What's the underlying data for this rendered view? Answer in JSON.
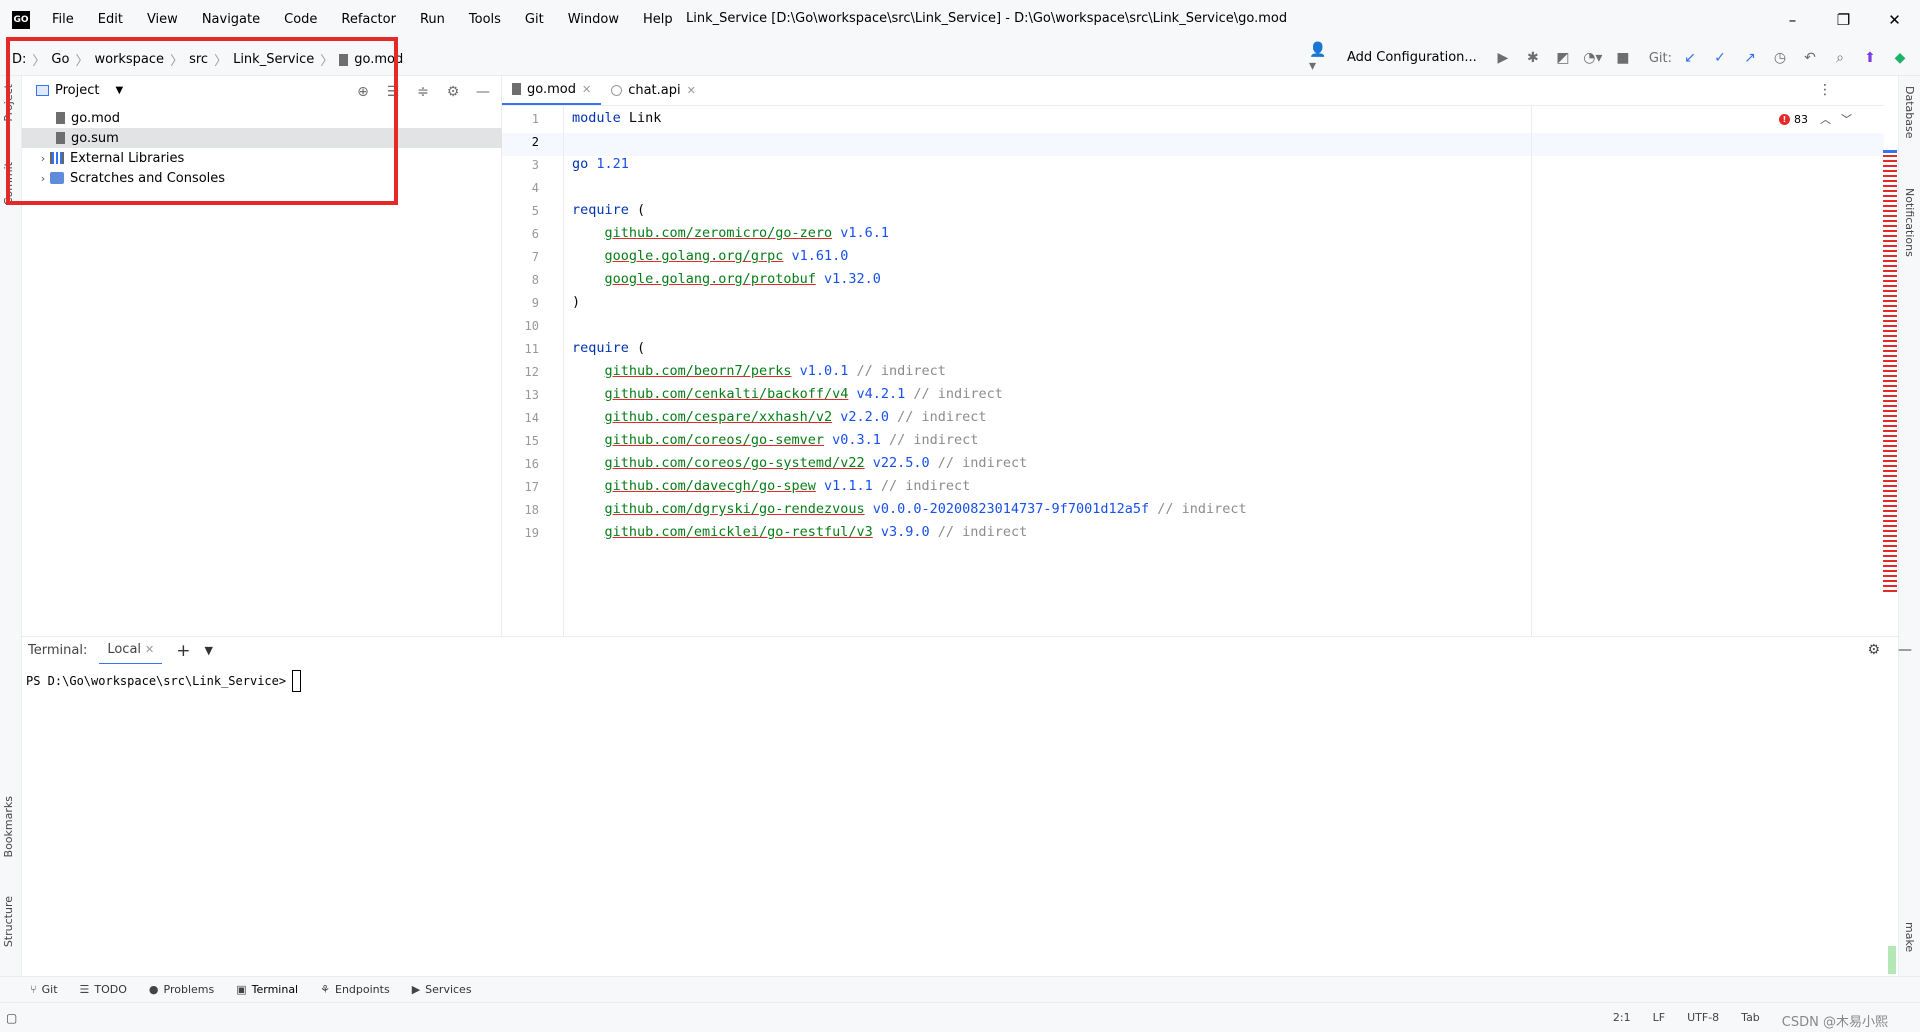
{
  "app": {
    "logo": "GO",
    "title": "Link_Service [D:\\Go\\workspace\\src\\Link_Service] - D:\\Go\\workspace\\src\\Link_Service\\go.mod"
  },
  "menu": [
    "File",
    "Edit",
    "View",
    "Navigate",
    "Code",
    "Refactor",
    "Run",
    "Tools",
    "Git",
    "Window",
    "Help"
  ],
  "window_controls": {
    "minimize": "–",
    "restore": "❐",
    "close": "✕"
  },
  "breadcrumb": [
    "D:",
    "Go",
    "workspace",
    "src",
    "Link_Service",
    "go.mod"
  ],
  "toolbar": {
    "add_configuration": "Add Configuration...",
    "git_label": "Git:"
  },
  "left_tool_tabs": {
    "project": "Project",
    "commit": "Commit",
    "bookmarks": "Bookmarks",
    "structure": "Structure"
  },
  "right_tool_tabs": {
    "database": "Database",
    "notifications": "Notifications",
    "make": "make"
  },
  "project_panel": {
    "title": "Project",
    "items": [
      {
        "label": "go.mod"
      },
      {
        "label": "go.sum"
      },
      {
        "label": "External Libraries"
      },
      {
        "label": "Scratches and Consoles"
      }
    ]
  },
  "editor": {
    "tabs": [
      {
        "label": "go.mod",
        "active": true
      },
      {
        "label": "chat.api",
        "active": false
      }
    ],
    "error_count": "83",
    "line_numbers": [
      "1",
      "2",
      "3",
      "4",
      "5",
      "6",
      "7",
      "8",
      "9",
      "10",
      "11",
      "12",
      "13",
      "14",
      "15",
      "16",
      "17",
      "18",
      "19"
    ],
    "current_line": "2",
    "code": {
      "l1_kw": "module",
      "l1_name": "Link",
      "l3_kw": "go",
      "l3_ver": "1.21",
      "l5_kw": "require",
      "l5_paren": "(",
      "l6_path": "github.com/zeromicro/go-zero",
      "l6_ver": "v1.6.1",
      "l7_path": "google.golang.org/grpc",
      "l7_ver": "v1.61.0",
      "l8_path": "google.golang.org/protobuf",
      "l8_ver": "v1.32.0",
      "l9_paren": ")",
      "l11_kw": "require",
      "l11_paren": "(",
      "l12_path": "github.com/beorn7/perks",
      "l12_ver": "v1.0.1",
      "l13_path": "github.com/cenkalti/backoff/v4",
      "l13_ver": "v4.2.1",
      "l14_path": "github.com/cespare/xxhash/v2",
      "l14_ver": "v2.2.0",
      "l15_path": "github.com/coreos/go-semver",
      "l15_ver": "v0.3.1",
      "l16_path": "github.com/coreos/go-systemd/v22",
      "l16_ver": "v22.5.0",
      "l17_path": "github.com/davecgh/go-spew",
      "l17_ver": "v1.1.1",
      "l18_path": "github.com/dgryski/go-rendezvous",
      "l18_ver": "v0.0.0-20200823014737-9f7001d12a5f",
      "l19_path": "github.com/emicklei/go-restful/v3",
      "l19_ver": "v3.9.0",
      "comment": "// indirect"
    }
  },
  "terminal": {
    "label": "Terminal:",
    "tab": "Local",
    "prompt": "PS D:\\Go\\workspace\\src\\Link_Service>"
  },
  "bottom_tools": [
    "Git",
    "TODO",
    "Problems",
    "Terminal",
    "Endpoints",
    "Services"
  ],
  "status": {
    "position": "2:1",
    "line_sep": "LF",
    "encoding": "UTF-8",
    "indent": "Tab",
    "watermark": "CSDN @木易小熙"
  },
  "colors": {
    "accent": "#3574f0",
    "error": "#e52929",
    "keyword": "#0033b3",
    "string": "#067d17"
  }
}
